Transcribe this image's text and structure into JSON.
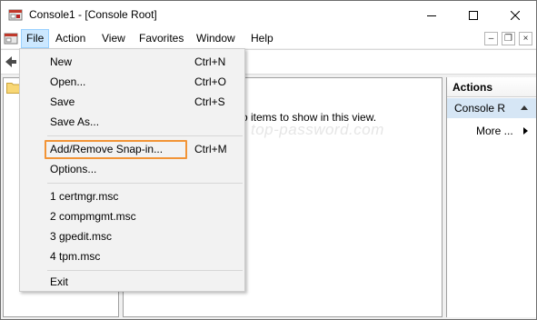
{
  "window": {
    "title": "Console1 - [Console Root]",
    "controls": {
      "minimize": "—",
      "maximize": "☐",
      "close": "✕"
    }
  },
  "menubar": {
    "items": [
      "File",
      "Action",
      "View",
      "Favorites",
      "Window",
      "Help"
    ],
    "active": "File",
    "mdi_controls": {
      "minimize": "–",
      "restore": "❐",
      "close": "×"
    }
  },
  "center": {
    "empty_message": "There are no items to show in this view.",
    "visible_message": "o items to show in this view.",
    "watermark": "top-password.com"
  },
  "actions_pane": {
    "header": "Actions",
    "selected_item": "Console R",
    "more_label": "More ..."
  },
  "file_menu": {
    "group1": [
      {
        "label": "New",
        "shortcut": "Ctrl+N"
      },
      {
        "label": "Open...",
        "shortcut": "Ctrl+O"
      },
      {
        "label": "Save",
        "shortcut": "Ctrl+S"
      },
      {
        "label": "Save As...",
        "shortcut": ""
      }
    ],
    "group2": [
      {
        "label": "Add/Remove Snap-in...",
        "shortcut": "Ctrl+M"
      },
      {
        "label": "Options...",
        "shortcut": ""
      }
    ],
    "recent": [
      "1 certmgr.msc",
      "2 compmgmt.msc",
      "3 gpedit.msc",
      "4 tpm.msc"
    ],
    "exit_label": "Exit"
  },
  "colors": {
    "menu_highlight_border": "#f29436",
    "active_menu_bg": "#cce8ff",
    "selected_action_bg": "#d6e6f5"
  }
}
